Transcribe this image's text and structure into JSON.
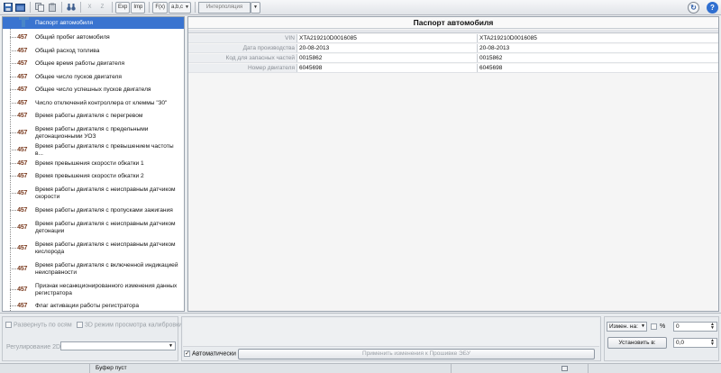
{
  "toolbar": {
    "btn_exp": "Exp",
    "btn_imp": "Imp",
    "btn_fx": "F(x)",
    "btn_abc": "a,b,c",
    "btn_x": "X",
    "btn_z": "Z",
    "interpolation": "Интерполяция"
  },
  "tree": {
    "badge": "457",
    "items": [
      "Паспорт автомобиля",
      "Общий пробег автомобиля",
      "Общий расход топлива",
      "Общее время работы двигателя",
      "Общее число пусков двигателя",
      "Общее число успешных пусков двигателя",
      "Число отключений контроллера от клеммы \"30\"",
      "Время работы двигателя с перегревом",
      "Время работы двигателя с предельными детонационными УОЗ",
      "Время работы двигателя с превышением частоты в...",
      "Время превышения скорости обкатки 1",
      "Время превышения скорости обкатки 2",
      "Время работы двигателя с неисправным датчиком скорости",
      "Время работы двигателя с пропусками зажигания",
      "Время работы двигателя с неисправным датчиком детонации",
      "Время работы двигателя с неисправным датчиком кислорода",
      "Время работы двигателя с включенной индикацией неисправности",
      "Признак несанкционированного изменения данных регистратора",
      "Флаг активации работы регистратора"
    ]
  },
  "passport": {
    "title": "Паспорт автомобиля",
    "rows": [
      {
        "key": "VIN",
        "value": "XTA219210D0016085",
        "value2": "XTA219210D0016085"
      },
      {
        "key": "Дата производства",
        "value": "20-08-2013",
        "value2": "20-08-2013"
      },
      {
        "key": "Код для запасных частей",
        "value": "0015862",
        "value2": "0015862"
      },
      {
        "key": "Номер двигателя",
        "value": "6045698",
        "value2": "6045698"
      }
    ]
  },
  "bottom": {
    "expand_axes": "Развернуть по осям",
    "mode_3d": "3D режим просмотра калибровки",
    "regulation_2d": "Регулирование 2D:",
    "auto": "Автоматически",
    "apply_btn": "Применить изменения к Прошивке ЭБУ",
    "change_label": "Измен. на:",
    "percent": "%",
    "value1": "0",
    "set_label": "Установить в:",
    "value2": "0,0"
  },
  "status": {
    "buffer": "Буфер пуст"
  }
}
